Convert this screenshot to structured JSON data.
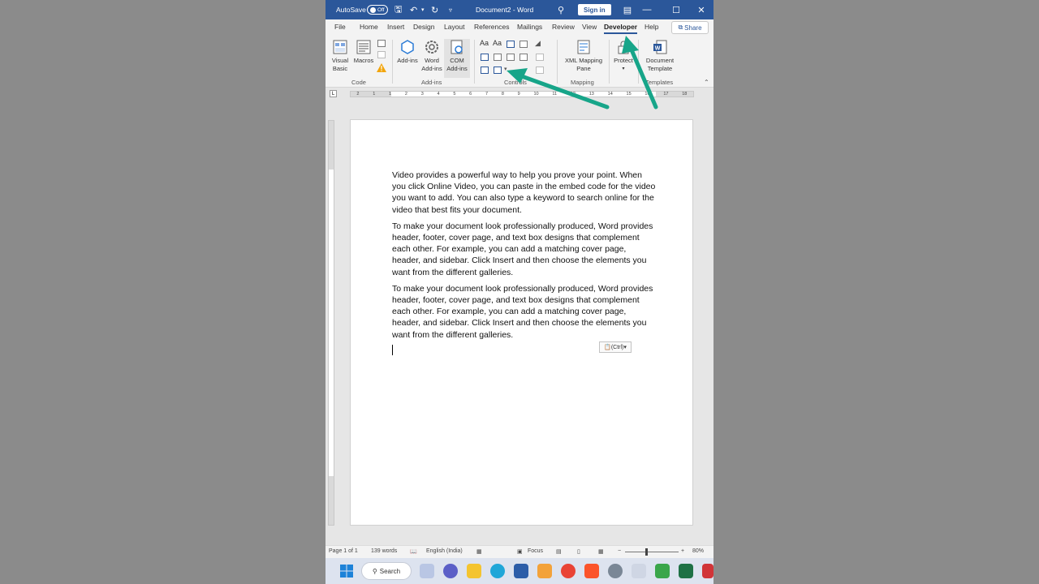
{
  "titlebar": {
    "autosave_label": "AutoSave",
    "autosave_state": "Off",
    "document_title": "Document2 - Word",
    "signin_label": "Sign in"
  },
  "tabs": [
    "File",
    "Home",
    "Insert",
    "Design",
    "Layout",
    "References",
    "Mailings",
    "Review",
    "View",
    "Developer",
    "Help"
  ],
  "active_tab": "Developer",
  "share_label": "Share",
  "ribbon": {
    "code": {
      "group_label": "Code",
      "visual_basic": "Visual Basic",
      "macros": "Macros"
    },
    "addins": {
      "group_label": "Add-ins",
      "add_ins": "Add-ins",
      "word_add_ins": "Word Add-ins",
      "com_add_ins": "COM Add-ins"
    },
    "controls": {
      "group_label": "Controls"
    },
    "mapping": {
      "group_label": "Mapping",
      "xml_pane": "XML Mapping Pane"
    },
    "protect": {
      "label": "Protect"
    },
    "templates": {
      "group_label": "Templates",
      "document_template": "Document Template"
    }
  },
  "ruler_numbers": [
    "2",
    "1",
    "1",
    "2",
    "3",
    "4",
    "5",
    "6",
    "7",
    "8",
    "9",
    "10",
    "11",
    "12",
    "13",
    "14",
    "15",
    "16",
    "17",
    "18"
  ],
  "document": {
    "paragraphs": [
      "Video provides a powerful way to help you prove your point. When you click Online Video, you can paste in the embed code for the video you want to add. You can also type a keyword to search online for the video that best fits your document.",
      "To make your document look professionally produced, Word provides header, footer, cover page, and text box designs that complement each other. For example, you can add a matching cover page, header, and sidebar. Click Insert and then choose the elements you want from the different galleries.",
      "To make your document look professionally produced, Word provides header, footer, cover page, and text box designs that complement each other. For example, you can add a matching cover page, header, and sidebar. Click Insert and then choose the elements you want from the different galleries."
    ],
    "paste_options": "(Ctrl)"
  },
  "status": {
    "page": "Page 1 of 1",
    "words": "139 words",
    "language": "English (India)",
    "focus": "Focus",
    "zoom": "80%"
  },
  "taskbar": {
    "search_label": "Search"
  },
  "colors": {
    "word_blue": "#2b579a",
    "annotation_arrow": "#17a589"
  }
}
